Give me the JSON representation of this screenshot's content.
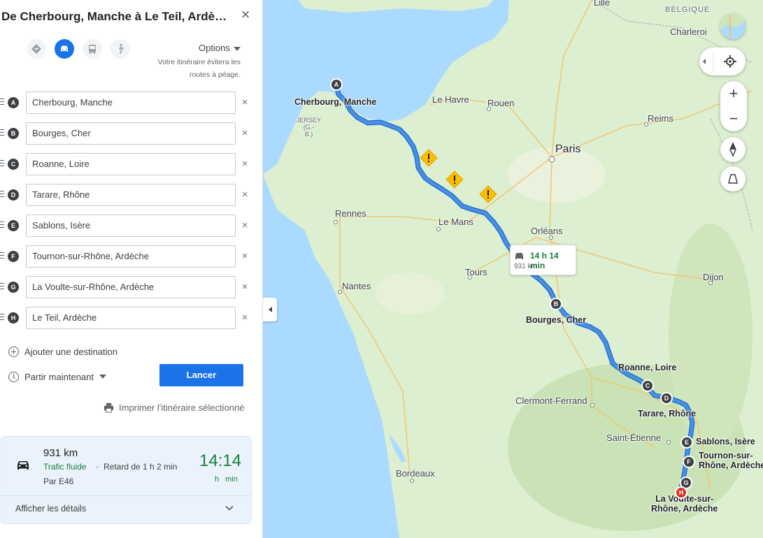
{
  "title": "De Cherbourg, Manche à Le Teil, Ardèche",
  "modes": [
    {
      "name": "best",
      "active": false
    },
    {
      "name": "driving",
      "active": true
    },
    {
      "name": "transit",
      "active": false
    },
    {
      "name": "walking",
      "active": false
    }
  ],
  "options_label": "Options",
  "toll_note": "Votre itinéraire évitera les routes à péage.",
  "stops": [
    {
      "letter": "A",
      "value": "Cherbourg, Manche"
    },
    {
      "letter": "B",
      "value": "Bourges, Cher"
    },
    {
      "letter": "C",
      "value": "Roanne, Loire"
    },
    {
      "letter": "D",
      "value": "Tarare, Rhône"
    },
    {
      "letter": "E",
      "value": "Sablons, Isère"
    },
    {
      "letter": "F",
      "value": "Tournon-sur-Rhône, Ardèche"
    },
    {
      "letter": "G",
      "value": "La Voulte-sur-Rhône, Ardèche"
    },
    {
      "letter": "H",
      "value": "Le Teil, Ardèche"
    }
  ],
  "add_destination": "Ajouter une destination",
  "depart_label": "Partir maintenant",
  "launch_label": "Lancer",
  "print_label": "Imprimer l'itinéraire sélectionné",
  "route": {
    "distance": "931 km",
    "traffic": "Trafic fluide",
    "separator": "·",
    "delay": "Retard de 1 h 2 min",
    "via": "Par E46",
    "duration": "14:14",
    "duration_units": "h min",
    "details_label": "Afficher les détails"
  },
  "map": {
    "bubble_time": "14 h 14 min",
    "bubble_dist": "931 km",
    "cities": {
      "lille": "Lille",
      "belgique": "BELGIQUE",
      "charleroi": "Charleroi",
      "cherbourg": "Cherbourg, Manche",
      "jersey": "JERSEY\n(G.-\nB.)",
      "le_havre": "Le Havre",
      "rouen": "Rouen",
      "reims": "Reims",
      "paris": "Paris",
      "rennes": "Rennes",
      "le_mans": "Le Mans",
      "orleans": "Orléans",
      "tours": "Tours",
      "nantes": "Nantes",
      "bourges": "Bourges, Cher",
      "dijon": "Dijon",
      "roanne": "Roanne, Loire",
      "clermont": "Clermont-Ferrand",
      "tarare": "Tarare, Rhône",
      "saint_etienne": "Saint-Étienne",
      "sablons": "Sablons, Isère",
      "tournon": "Tournon-sur-\nRhône, Ardèche",
      "bordeaux": "Bordeaux",
      "voulte": "La Voulte-sur-\nRhône, Ardèche"
    },
    "colors": {
      "land": "#dcefd0",
      "water": "#aadaff",
      "route": "#4a90e2",
      "accent": "#1a73e8"
    }
  }
}
